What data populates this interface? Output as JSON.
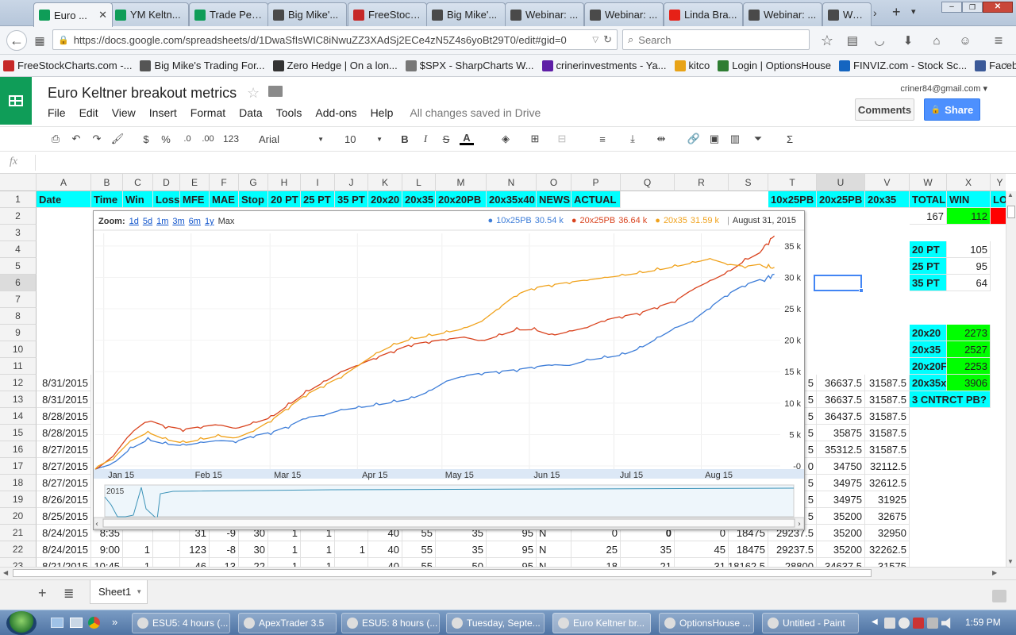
{
  "browser": {
    "tabs": [
      {
        "label": "Euro ...",
        "icon": "sheets-icon",
        "active": true
      },
      {
        "label": "YM Keltn...",
        "icon": "sheets-icon"
      },
      {
        "label": "Trade Per...",
        "icon": "sheets-icon"
      },
      {
        "label": "Big Mike'...",
        "icon": "bm-icon"
      },
      {
        "label": "FreeStock...",
        "icon": "freestock-icon"
      },
      {
        "label": "Big Mike'...",
        "icon": "bm-icon"
      },
      {
        "label": "Webinar: ...",
        "icon": "bm-icon"
      },
      {
        "label": "Webinar: ...",
        "icon": "bm-icon"
      },
      {
        "label": "Linda Bra...",
        "icon": "youtube-icon"
      },
      {
        "label": "Webinar: ...",
        "icon": "bm-icon"
      },
      {
        "label": "Webi",
        "icon": "bm-icon"
      }
    ],
    "url": "https://docs.google.com/spreadsheets/d/1DwaSfIsWIC8iNwuZZ3XAdSj2ECe4zN5Z4s6yoBt29T0/edit#gid=0",
    "search_placeholder": "Search",
    "bookmarks": [
      {
        "label": "FreeStockCharts.com -...",
        "color": "#c62828"
      },
      {
        "label": "Big Mike's Trading For...",
        "color": "#555555"
      },
      {
        "label": "Zero Hedge | On a lon...",
        "color": "#333333"
      },
      {
        "label": "$SPX - SharpCharts W...",
        "color": "#777777"
      },
      {
        "label": "crinerinvestments - Ya...",
        "color": "#5e1ea6"
      },
      {
        "label": "kitco",
        "color": "#e8a317"
      },
      {
        "label": "Login | OptionsHouse",
        "color": "#2e7d32"
      },
      {
        "label": "FINVIZ.com - Stock Sc...",
        "color": "#1565c0"
      },
      {
        "label": "Facebook logo",
        "color": "#3b5998"
      }
    ]
  },
  "doc": {
    "title": "Euro Keltner breakout metrics",
    "menu": [
      "File",
      "Edit",
      "View",
      "Insert",
      "Format",
      "Data",
      "Tools",
      "Add-ons",
      "Help"
    ],
    "save_status": "All changes saved in Drive",
    "account": "criner84@gmail.com",
    "comments_label": "Comments",
    "share_label": "Share",
    "toolbar": {
      "dollar": "$",
      "percent": "%",
      "dec_less": ".0",
      "dec_more": ".00",
      "more_formats": "123",
      "font": "Arial",
      "font_size": "10",
      "bold": "B",
      "italic": "I",
      "strike": "S",
      "text_color": "A"
    },
    "fx": "fx"
  },
  "sheet": {
    "columns": [
      "A",
      "B",
      "C",
      "D",
      "E",
      "F",
      "G",
      "H",
      "I",
      "J",
      "K",
      "L",
      "M",
      "N",
      "O",
      "P",
      "Q",
      "R",
      "S",
      "T",
      "U",
      "V",
      "W",
      "X",
      "Y"
    ],
    "row_numbers": [
      "1",
      "2",
      "3",
      "4",
      "5",
      "6",
      "7",
      "8",
      "9",
      "10",
      "11",
      "12",
      "13",
      "14",
      "15",
      "16",
      "17",
      "18",
      "19",
      "20",
      "21",
      "22",
      "23"
    ],
    "header_row": [
      "Date",
      "Time",
      "Win",
      "Loss",
      "MFE",
      "MAE",
      "Stop",
      "20 PT",
      "25 PT",
      "35 PT",
      "20x20",
      "20x35",
      "20x20PB",
      "20x35x40",
      "NEWS",
      "ACTUAL",
      "",
      "",
      "",
      "10x25PB",
      "20x25PB",
      "20x35",
      "TOTAL",
      "WIN",
      "LO"
    ],
    "left_rows": [
      {
        "row": 12,
        "A": "8/31/2015"
      },
      {
        "row": 13,
        "A": "8/31/2015"
      },
      {
        "row": 14,
        "A": "8/28/2015"
      },
      {
        "row": 15,
        "A": "8/28/2015"
      },
      {
        "row": 16,
        "A": "8/27/2015"
      },
      {
        "row": 17,
        "A": "8/27/2015"
      },
      {
        "row": 18,
        "A": "8/27/2015"
      },
      {
        "row": 19,
        "A": "8/26/2015"
      },
      {
        "row": 20,
        "A": "8/25/2015"
      }
    ],
    "row21": [
      "8/24/2015",
      "8:35",
      "",
      "",
      "31",
      "-9",
      "30",
      "1",
      "1",
      "",
      "40",
      "55",
      "35",
      "95",
      "N",
      "0",
      "0",
      "0",
      "18475",
      "29237.5",
      "35200",
      "32950"
    ],
    "row22": [
      "8/24/2015",
      "9:00",
      "1",
      "",
      "123",
      "-8",
      "30",
      "1",
      "1",
      "1",
      "40",
      "55",
      "35",
      "95",
      "N",
      "25",
      "35",
      "45",
      "18475",
      "29237.5",
      "35200",
      "32262.5"
    ],
    "row23": [
      "8/21/2015",
      "10:45",
      "1",
      "",
      "46",
      "-13",
      "22",
      "1",
      "1",
      "",
      "40",
      "55",
      "50",
      "95",
      "N",
      "18",
      "21",
      "31",
      "18162.5",
      "28800",
      "34637.5",
      "31575"
    ],
    "right_rows": [
      {
        "row": 12,
        "T": "5",
        "U": "36637.5",
        "V": "31587.5"
      },
      {
        "row": 13,
        "T": "5",
        "U": "36637.5",
        "V": "31587.5"
      },
      {
        "row": 14,
        "T": "5",
        "U": "36437.5",
        "V": "31587.5"
      },
      {
        "row": 15,
        "T": "5",
        "U": "35875",
        "V": "31587.5"
      },
      {
        "row": 16,
        "T": "5",
        "U": "35312.5",
        "V": "31587.5"
      },
      {
        "row": 17,
        "T": "0",
        "U": "34750",
        "V": "32112.5"
      },
      {
        "row": 18,
        "T": "5",
        "U": "34975",
        "V": "32612.5"
      },
      {
        "row": 19,
        "T": "5",
        "U": "34975",
        "V": "31925"
      },
      {
        "row": 20,
        "T": "5",
        "U": "35200",
        "V": "32675"
      }
    ],
    "summary": {
      "total": "167",
      "win": "112",
      "pt20_label": "20 PT",
      "pt20": "105",
      "pt25_label": "25 PT",
      "pt25": "95",
      "pt35_label": "35 PT",
      "pt35": "64",
      "x2020_label": "20x20",
      "x2020": "2273",
      "x2035_label": "20x35",
      "x2035": "2527",
      "x2020pb_label": "20x20F",
      "x2020pb": "2253",
      "x2035x_label": "20x35x",
      "x2035x": "3906",
      "cntr_label": "3 CNTRCT PB?"
    },
    "sheet_tab": "Sheet1"
  },
  "chart_data": {
    "type": "line",
    "zoom_label": "Zoom:",
    "zoom_options": [
      "1d",
      "5d",
      "1m",
      "3m",
      "6m",
      "1y",
      "Max"
    ],
    "date_readout": "August 31, 2015",
    "series": [
      {
        "name": "10x25PB",
        "readout": "30.54 k",
        "color": "#3d7dd8",
        "points": [
          [
            0,
            -0.5
          ],
          [
            3,
            0.5
          ],
          [
            6,
            3
          ],
          [
            9,
            4.5
          ],
          [
            12,
            3.8
          ],
          [
            15,
            3.5
          ],
          [
            18,
            3.8
          ],
          [
            21,
            4
          ],
          [
            24,
            3.7
          ],
          [
            27,
            4.5
          ],
          [
            30,
            5
          ],
          [
            33,
            6
          ],
          [
            36,
            7.5
          ],
          [
            39,
            8
          ],
          [
            42,
            9
          ],
          [
            45,
            9.5
          ],
          [
            48,
            10
          ],
          [
            51,
            10.5
          ],
          [
            54,
            11
          ],
          [
            57,
            12
          ],
          [
            60,
            13.5
          ],
          [
            63,
            14.2
          ],
          [
            66,
            14.5
          ],
          [
            69,
            14.7
          ],
          [
            72,
            15
          ],
          [
            75,
            15.5
          ],
          [
            78,
            16
          ],
          [
            81,
            16
          ],
          [
            84,
            17
          ],
          [
            87,
            17.5
          ],
          [
            90,
            18
          ],
          [
            93,
            19
          ],
          [
            96,
            20.5
          ],
          [
            99,
            22
          ],
          [
            102,
            23
          ],
          [
            105,
            25
          ],
          [
            108,
            27
          ],
          [
            111,
            28.5
          ],
          [
            114,
            29.5
          ],
          [
            116,
            30.5
          ]
        ]
      },
      {
        "name": "20x25PB",
        "readout": "36.64 k",
        "color": "#d9431e",
        "points": [
          [
            0,
            -0.5
          ],
          [
            3,
            1.5
          ],
          [
            6,
            5
          ],
          [
            9,
            7
          ],
          [
            12,
            6
          ],
          [
            15,
            5.5
          ],
          [
            18,
            6
          ],
          [
            21,
            6.5
          ],
          [
            24,
            6
          ],
          [
            27,
            7
          ],
          [
            30,
            8
          ],
          [
            33,
            10
          ],
          [
            36,
            12
          ],
          [
            39,
            13.5
          ],
          [
            42,
            15
          ],
          [
            45,
            16
          ],
          [
            48,
            17
          ],
          [
            51,
            18
          ],
          [
            54,
            19
          ],
          [
            57,
            19.5
          ],
          [
            60,
            20
          ],
          [
            63,
            20.5
          ],
          [
            66,
            20
          ],
          [
            69,
            21
          ],
          [
            72,
            22
          ],
          [
            75,
            22
          ],
          [
            78,
            21
          ],
          [
            81,
            21.5
          ],
          [
            84,
            22
          ],
          [
            87,
            23
          ],
          [
            90,
            23.5
          ],
          [
            93,
            24
          ],
          [
            96,
            25
          ],
          [
            99,
            26
          ],
          [
            102,
            28
          ],
          [
            105,
            29.5
          ],
          [
            108,
            31
          ],
          [
            111,
            33
          ],
          [
            114,
            34.5
          ],
          [
            116,
            36.6
          ]
        ]
      },
      {
        "name": "20x35",
        "readout": "31.59 k",
        "color": "#f0a21c",
        "points": [
          [
            0,
            -0.5
          ],
          [
            3,
            1
          ],
          [
            6,
            4
          ],
          [
            9,
            5.5
          ],
          [
            12,
            4.5
          ],
          [
            15,
            4
          ],
          [
            18,
            4.5
          ],
          [
            21,
            5
          ],
          [
            24,
            4.5
          ],
          [
            27,
            5.5
          ],
          [
            30,
            7
          ],
          [
            33,
            9
          ],
          [
            36,
            11
          ],
          [
            39,
            12.5
          ],
          [
            42,
            14
          ],
          [
            45,
            16
          ],
          [
            48,
            18
          ],
          [
            51,
            19.5
          ],
          [
            54,
            20.5
          ],
          [
            57,
            21
          ],
          [
            60,
            21.5
          ],
          [
            63,
            22
          ],
          [
            66,
            23
          ],
          [
            69,
            25
          ],
          [
            72,
            27
          ],
          [
            75,
            28
          ],
          [
            78,
            28.5
          ],
          [
            81,
            29
          ],
          [
            84,
            29.5
          ],
          [
            87,
            30
          ],
          [
            90,
            30.5
          ],
          [
            93,
            31
          ],
          [
            96,
            31.5
          ],
          [
            99,
            32
          ],
          [
            102,
            32.5
          ],
          [
            105,
            33
          ],
          [
            108,
            32
          ],
          [
            111,
            31.5
          ],
          [
            114,
            31.8
          ],
          [
            116,
            31.6
          ]
        ]
      }
    ],
    "x_ticks": [
      "Jan 15",
      "Feb 15",
      "Mar 15",
      "Apr 15",
      "May 15",
      "Jun 15",
      "Jul 15",
      "Aug 15"
    ],
    "y_ticks": [
      "-0",
      "5 k",
      "10 k",
      "15 k",
      "20 k",
      "25 k",
      "30 k",
      "35 k"
    ],
    "ylim": [
      -0.5,
      37
    ],
    "navigator_label": "2015"
  },
  "taskbar": {
    "items": [
      "ESU5: 4 hours (...",
      "ApexTrader 3.5",
      "ESU5: 8 hours (...",
      "Tuesday, Septe...",
      "Euro Keltner br...",
      "OptionsHouse ...",
      "Untitled - Paint"
    ],
    "time": "1:59 PM"
  }
}
